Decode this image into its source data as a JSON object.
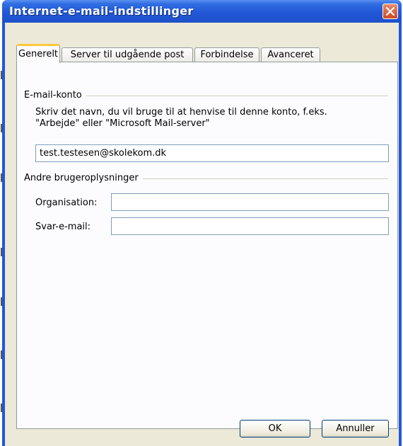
{
  "window": {
    "title": "Internet-e-mail-indstillinger"
  },
  "tabs": [
    {
      "label": "Generelt",
      "active": true
    },
    {
      "label": "Server til udgående post",
      "active": false
    },
    {
      "label": "Forbindelse",
      "active": false
    },
    {
      "label": "Avanceret",
      "active": false
    }
  ],
  "email_account": {
    "heading": "E-mail-konto",
    "description_line1": "Skriv det navn, du vil bruge til at henvise til denne konto, f.eks.",
    "description_line2": "\"Arbejde\" eller \"Microsoft Mail-server\"",
    "account_name_value": "test.testesen@skolekom.dk"
  },
  "user_info": {
    "heading": "Andre brugeroplysninger",
    "organisation_label": "Organisation:",
    "organisation_value": "",
    "reply_email_label": "Svar-e-mail:",
    "reply_email_value": ""
  },
  "buttons": {
    "ok": "OK",
    "cancel": "Annuller"
  },
  "colors": {
    "titlebar": "#2257d6",
    "dialog_bg": "#ece9d8",
    "active_tab_accent": "#ffc83c",
    "close_button": "#cf4a22"
  }
}
